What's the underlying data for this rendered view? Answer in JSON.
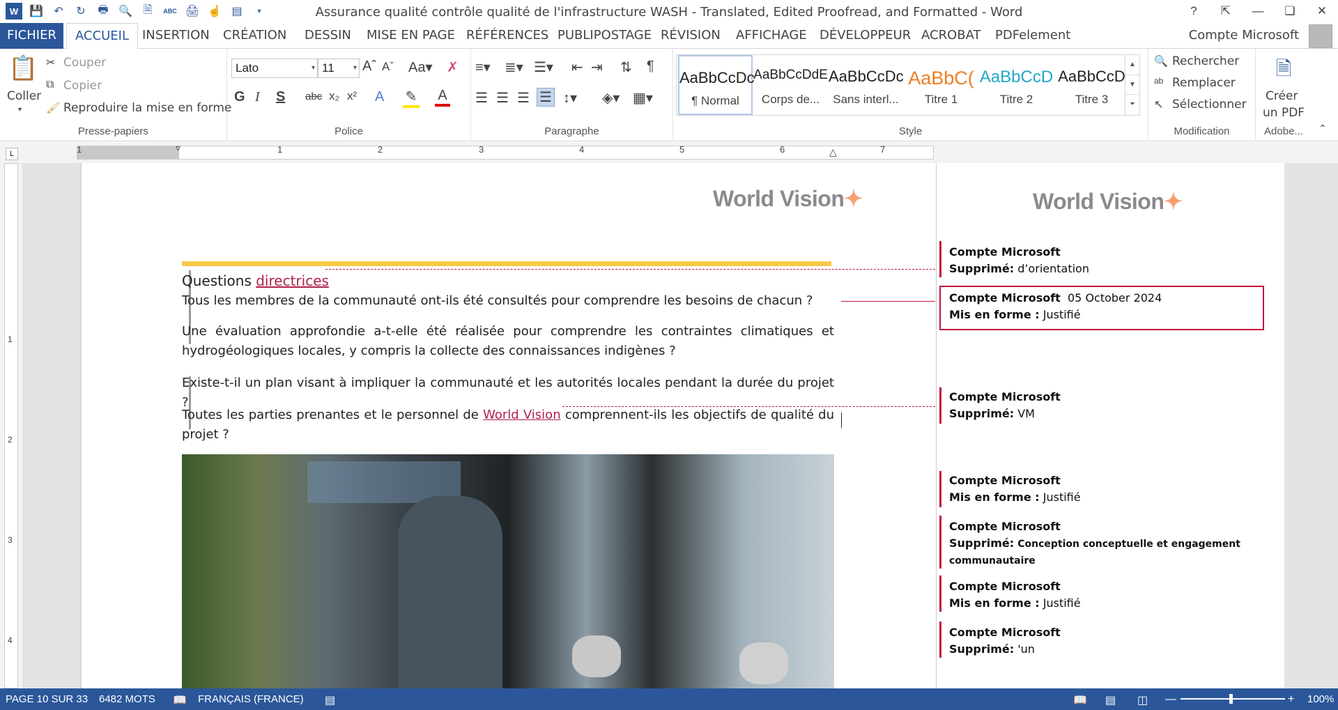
{
  "window": {
    "title": "Assurance qualité  contrôle qualité de l'infrastructure WASH - Translated, Edited Proofread, and Formatted - Word",
    "help": "?",
    "controls": [
      "ribbon-display",
      "minimize",
      "restore",
      "close"
    ]
  },
  "tabs": {
    "file": "FICHIER",
    "items": [
      "ACCUEIL",
      "INSERTION",
      "CRÉATION",
      "DESSIN",
      "MISE EN PAGE",
      "RÉFÉRENCES",
      "PUBLIPOSTAGE",
      "RÉVISION",
      "AFFICHAGE",
      "DÉVELOPPEUR",
      "ACROBAT",
      "PDFelement"
    ],
    "active": "ACCUEIL",
    "account": "Compte Microsoft"
  },
  "ribbon": {
    "clipboard": {
      "paste": "Coller",
      "cut": "Couper",
      "copy": "Copier",
      "format_painter": "Reproduire la mise en forme",
      "label": "Presse-papiers"
    },
    "font": {
      "name": "Lato",
      "size": "11",
      "label": "Police"
    },
    "paragraph": {
      "label": "Paragraphe"
    },
    "styles": {
      "label": "Style",
      "items": [
        {
          "sample": "AaBbCcDc",
          "name": "¶ Normal",
          "color": "#222222"
        },
        {
          "sample": "AaBbCcDdE",
          "name": "Corps de...",
          "color": "#222222"
        },
        {
          "sample": "AaBbCcDc",
          "name": "Sans interl...",
          "color": "#222222"
        },
        {
          "sample": "AaBbC(",
          "name": "Titre 1",
          "color": "#ef7d22"
        },
        {
          "sample": "AaBbCcD",
          "name": "Titre 2",
          "color": "#1fa7c4"
        },
        {
          "sample": "AaBbCcD",
          "name": "Titre 3",
          "color": "#222222"
        }
      ]
    },
    "editing": {
      "find": "Rechercher",
      "replace": "Remplacer",
      "select": "Sélectionner",
      "label": "Modification"
    },
    "adobe": {
      "create_pdf_line1": "Créer",
      "create_pdf_line2": "un PDF",
      "label": "Adobe..."
    }
  },
  "ruler": {
    "numbers": [
      "1",
      "1",
      "2",
      "3",
      "4",
      "5",
      "6",
      "7"
    ],
    "vnumbers": [
      "1",
      "2",
      "3",
      "4"
    ]
  },
  "document": {
    "logo_text": "World Vision",
    "heading_plain": "Questions ",
    "heading_inserted": "directrices",
    "q1": "Tous les membres de la communauté ont-ils été consultés pour comprendre les besoins de chacun ?",
    "q2": "Une évaluation approfondie a-t-elle été réalisée pour comprendre les contraintes climatiques et hydrogéologiques locales, y compris la collecte des connaissances indigènes ?",
    "q3": "Existe-t-il un plan visant à impliquer la communauté et les autorités locales pendant la durée du projet ?",
    "q4_before": "Toutes les parties prenantes et le personnel de ",
    "q4_inserted": "World Vision",
    "q4_after": " comprennent-ils les objectifs de qualité du projet ?"
  },
  "comments": [
    {
      "author": "Compte Microsoft",
      "date": "",
      "action": "Supprimé:",
      "text": "d’orientation"
    },
    {
      "author": "Compte Microsoft",
      "date": "05 October 2024",
      "action": "Mis en forme :",
      "text": "Justifié"
    },
    {
      "author": "Compte Microsoft",
      "date": "",
      "action": "Supprimé:",
      "text": "VM"
    },
    {
      "author": "Compte Microsoft",
      "date": "",
      "action": "Mis en forme :",
      "text": "Justifié"
    },
    {
      "author": "Compte Microsoft",
      "date": "",
      "action": "Supprimé:",
      "text": "Conception conceptuelle et engagement communautaire"
    },
    {
      "author": "Compte Microsoft",
      "date": "",
      "action": "Mis en forme :",
      "text": "Justifié"
    },
    {
      "author": "Compte Microsoft",
      "date": "",
      "action": "Supprimé:",
      "text": "'un"
    }
  ],
  "status": {
    "page": "PAGE 10 SUR 33",
    "words": "6482 MOTS",
    "language": "FRANÇAIS (FRANCE)",
    "zoom": "100%"
  },
  "colors": {
    "accent": "#2b579a",
    "revision": "#c0143c",
    "highlight_bar": "#f7c948"
  }
}
